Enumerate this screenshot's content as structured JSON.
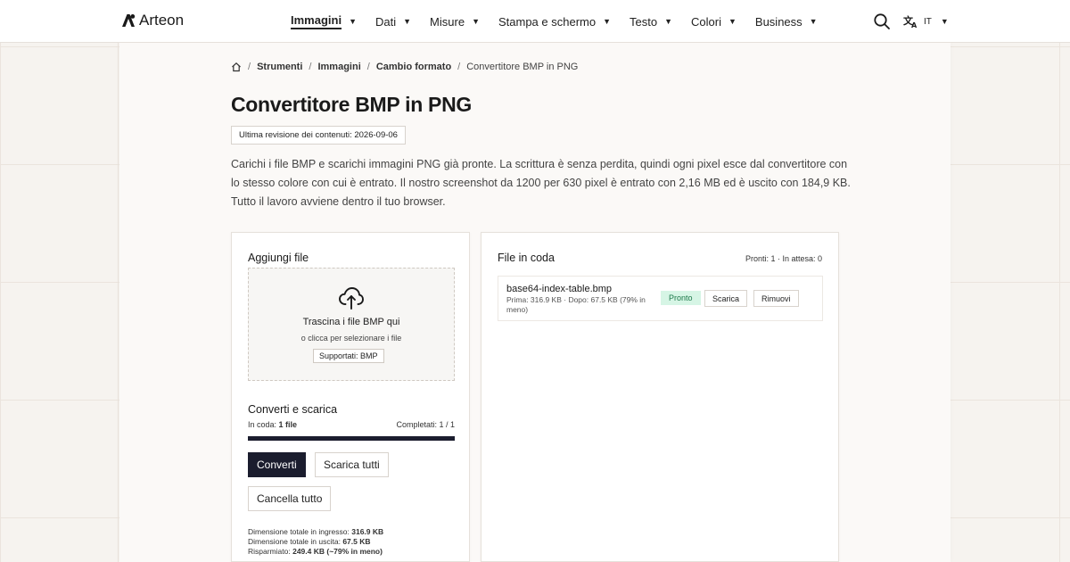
{
  "brand": {
    "name": "Arteon"
  },
  "nav": {
    "items": [
      {
        "label": "Immagini",
        "active": true
      },
      {
        "label": "Dati"
      },
      {
        "label": "Misure"
      },
      {
        "label": "Stampa e schermo"
      },
      {
        "label": "Testo"
      },
      {
        "label": "Colori"
      },
      {
        "label": "Business"
      }
    ],
    "language": "IT"
  },
  "breadcrumb": {
    "items": [
      "Strumenti",
      "Immagini",
      "Cambio formato"
    ],
    "current": "Convertitore BMP in PNG"
  },
  "page": {
    "title": "Convertitore BMP in PNG",
    "revision": "Ultima revisione dei contenuti: 2026-09-06",
    "intro": "Carichi i file BMP e scarichi immagini PNG già pronte. La scrittura è senza perdita, quindi ogni pixel esce dal convertitore con lo stesso colore con cui è entrato. Il nostro screenshot da 1200 per 630 pixel è entrato con 2,16 MB ed è uscito con 184,9 KB. Tutto il lavoro avviene dentro il tuo browser."
  },
  "upload": {
    "title": "Aggiungi file",
    "drop_primary": "Trascina i file BMP qui",
    "drop_secondary": "o clicca per selezionare i file",
    "supported": "Supportati: BMP"
  },
  "convert": {
    "title": "Converti e scarica",
    "queue_label": "In coda:",
    "queue_value": "1 file",
    "completed": "Completati: 1 / 1",
    "progress": 1.0,
    "convert_label": "Converti",
    "download_all_label": "Scarica tutti",
    "clear_label": "Cancella tutto",
    "stats": {
      "input_label": "Dimensione totale in ingresso:",
      "input_value": "316.9 KB",
      "output_label": "Dimensione totale in uscita:",
      "output_value": "67.5 KB",
      "saved_label": "Risparmiato:",
      "saved_value": "249.4 KB (~79% in meno)"
    }
  },
  "queue": {
    "title": "File in coda",
    "summary": "Pronti: 1 · In attesa: 0",
    "files": [
      {
        "name": "base64-index-table.bmp",
        "meta": "Prima: 316.9 KB · Dopo: 67.5 KB (79% in meno)",
        "status": "Pronto",
        "download_label": "Scarica",
        "remove_label": "Rimuovi"
      }
    ]
  },
  "colors": {
    "primary": "#1b1d2e",
    "ready_bg": "#d6f5e5",
    "ready_fg": "#1e7a4b",
    "page_bg": "#f6f3ef"
  }
}
